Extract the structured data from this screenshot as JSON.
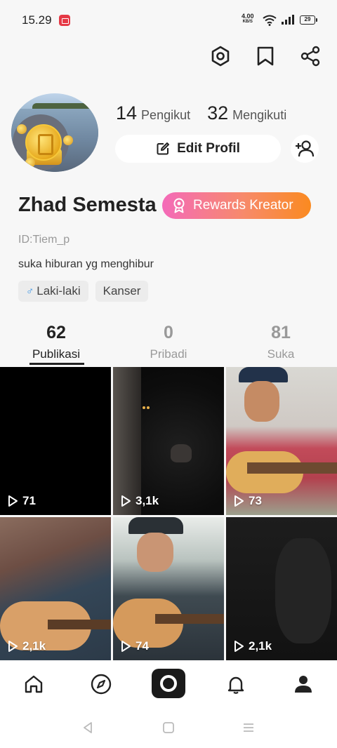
{
  "status_bar": {
    "time": "15.29",
    "net_speed": "4.00",
    "net_speed_unit": "KB/S",
    "battery": "29"
  },
  "header": {
    "icons": [
      "settings-icon",
      "bookmark-icon",
      "share-icon"
    ]
  },
  "profile": {
    "followers_count": "14",
    "followers_label": "Pengikut",
    "following_count": "32",
    "following_label": "Mengikuti",
    "edit_profile_label": "Edit Profil",
    "name": "Zhad Semesta",
    "rewards_label": "Rewards Kreator",
    "user_id": "ID:Tiem_p",
    "bio": "suka hiburan yg menghibur",
    "tags": [
      {
        "label": "Laki-laki",
        "icon": "male-icon"
      },
      {
        "label": "Kanser"
      }
    ]
  },
  "tabs": [
    {
      "count": "62",
      "label": "Publikasi",
      "active": true
    },
    {
      "count": "0",
      "label": "Pribadi",
      "active": false
    },
    {
      "count": "81",
      "label": "Suka",
      "active": false
    }
  ],
  "videos": [
    {
      "views": "71"
    },
    {
      "views": "3,1k"
    },
    {
      "views": "73"
    },
    {
      "views": "2,1k"
    },
    {
      "views": "74"
    },
    {
      "views": "2,1k"
    }
  ],
  "bottom_nav": {
    "items": [
      "home-icon",
      "discover-icon",
      "camera-icon",
      "notifications-icon",
      "profile-icon"
    ],
    "active": "profile-icon"
  },
  "colors": {
    "rewards_gradient_start": "#f46ab9",
    "rewards_gradient_end": "#fa8a20",
    "gender_icon": "#2e8fe5"
  }
}
